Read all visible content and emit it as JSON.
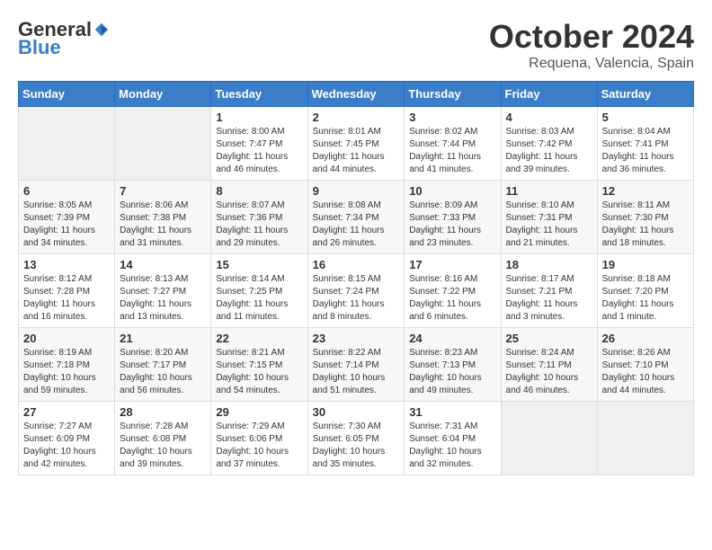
{
  "header": {
    "logo_general": "General",
    "logo_blue": "Blue",
    "month": "October 2024",
    "location": "Requena, Valencia, Spain"
  },
  "days_of_week": [
    "Sunday",
    "Monday",
    "Tuesday",
    "Wednesday",
    "Thursday",
    "Friday",
    "Saturday"
  ],
  "weeks": [
    [
      {
        "day": "",
        "info": ""
      },
      {
        "day": "",
        "info": ""
      },
      {
        "day": "1",
        "info": "Sunrise: 8:00 AM\nSunset: 7:47 PM\nDaylight: 11 hours and 46 minutes."
      },
      {
        "day": "2",
        "info": "Sunrise: 8:01 AM\nSunset: 7:45 PM\nDaylight: 11 hours and 44 minutes."
      },
      {
        "day": "3",
        "info": "Sunrise: 8:02 AM\nSunset: 7:44 PM\nDaylight: 11 hours and 41 minutes."
      },
      {
        "day": "4",
        "info": "Sunrise: 8:03 AM\nSunset: 7:42 PM\nDaylight: 11 hours and 39 minutes."
      },
      {
        "day": "5",
        "info": "Sunrise: 8:04 AM\nSunset: 7:41 PM\nDaylight: 11 hours and 36 minutes."
      }
    ],
    [
      {
        "day": "6",
        "info": "Sunrise: 8:05 AM\nSunset: 7:39 PM\nDaylight: 11 hours and 34 minutes."
      },
      {
        "day": "7",
        "info": "Sunrise: 8:06 AM\nSunset: 7:38 PM\nDaylight: 11 hours and 31 minutes."
      },
      {
        "day": "8",
        "info": "Sunrise: 8:07 AM\nSunset: 7:36 PM\nDaylight: 11 hours and 29 minutes."
      },
      {
        "day": "9",
        "info": "Sunrise: 8:08 AM\nSunset: 7:34 PM\nDaylight: 11 hours and 26 minutes."
      },
      {
        "day": "10",
        "info": "Sunrise: 8:09 AM\nSunset: 7:33 PM\nDaylight: 11 hours and 23 minutes."
      },
      {
        "day": "11",
        "info": "Sunrise: 8:10 AM\nSunset: 7:31 PM\nDaylight: 11 hours and 21 minutes."
      },
      {
        "day": "12",
        "info": "Sunrise: 8:11 AM\nSunset: 7:30 PM\nDaylight: 11 hours and 18 minutes."
      }
    ],
    [
      {
        "day": "13",
        "info": "Sunrise: 8:12 AM\nSunset: 7:28 PM\nDaylight: 11 hours and 16 minutes."
      },
      {
        "day": "14",
        "info": "Sunrise: 8:13 AM\nSunset: 7:27 PM\nDaylight: 11 hours and 13 minutes."
      },
      {
        "day": "15",
        "info": "Sunrise: 8:14 AM\nSunset: 7:25 PM\nDaylight: 11 hours and 11 minutes."
      },
      {
        "day": "16",
        "info": "Sunrise: 8:15 AM\nSunset: 7:24 PM\nDaylight: 11 hours and 8 minutes."
      },
      {
        "day": "17",
        "info": "Sunrise: 8:16 AM\nSunset: 7:22 PM\nDaylight: 11 hours and 6 minutes."
      },
      {
        "day": "18",
        "info": "Sunrise: 8:17 AM\nSunset: 7:21 PM\nDaylight: 11 hours and 3 minutes."
      },
      {
        "day": "19",
        "info": "Sunrise: 8:18 AM\nSunset: 7:20 PM\nDaylight: 11 hours and 1 minute."
      }
    ],
    [
      {
        "day": "20",
        "info": "Sunrise: 8:19 AM\nSunset: 7:18 PM\nDaylight: 10 hours and 59 minutes."
      },
      {
        "day": "21",
        "info": "Sunrise: 8:20 AM\nSunset: 7:17 PM\nDaylight: 10 hours and 56 minutes."
      },
      {
        "day": "22",
        "info": "Sunrise: 8:21 AM\nSunset: 7:15 PM\nDaylight: 10 hours and 54 minutes."
      },
      {
        "day": "23",
        "info": "Sunrise: 8:22 AM\nSunset: 7:14 PM\nDaylight: 10 hours and 51 minutes."
      },
      {
        "day": "24",
        "info": "Sunrise: 8:23 AM\nSunset: 7:13 PM\nDaylight: 10 hours and 49 minutes."
      },
      {
        "day": "25",
        "info": "Sunrise: 8:24 AM\nSunset: 7:11 PM\nDaylight: 10 hours and 46 minutes."
      },
      {
        "day": "26",
        "info": "Sunrise: 8:26 AM\nSunset: 7:10 PM\nDaylight: 10 hours and 44 minutes."
      }
    ],
    [
      {
        "day": "27",
        "info": "Sunrise: 7:27 AM\nSunset: 6:09 PM\nDaylight: 10 hours and 42 minutes."
      },
      {
        "day": "28",
        "info": "Sunrise: 7:28 AM\nSunset: 6:08 PM\nDaylight: 10 hours and 39 minutes."
      },
      {
        "day": "29",
        "info": "Sunrise: 7:29 AM\nSunset: 6:06 PM\nDaylight: 10 hours and 37 minutes."
      },
      {
        "day": "30",
        "info": "Sunrise: 7:30 AM\nSunset: 6:05 PM\nDaylight: 10 hours and 35 minutes."
      },
      {
        "day": "31",
        "info": "Sunrise: 7:31 AM\nSunset: 6:04 PM\nDaylight: 10 hours and 32 minutes."
      },
      {
        "day": "",
        "info": ""
      },
      {
        "day": "",
        "info": ""
      }
    ]
  ]
}
